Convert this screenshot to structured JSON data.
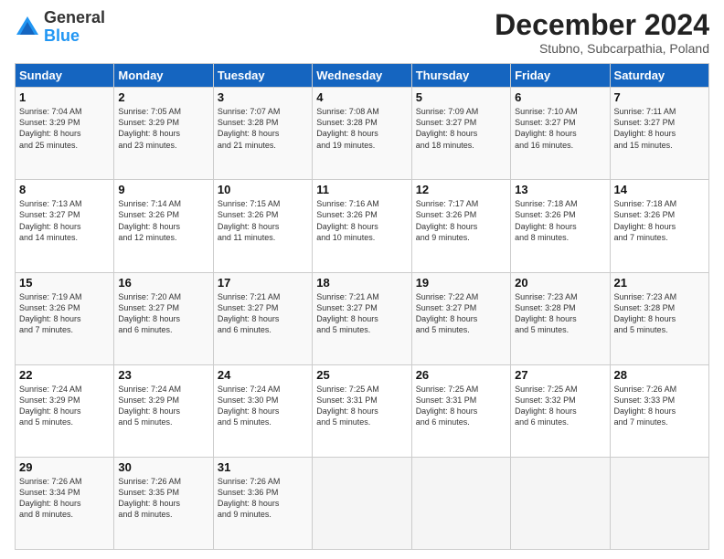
{
  "logo": {
    "general": "General",
    "blue": "Blue"
  },
  "title": "December 2024",
  "subtitle": "Stubno, Subcarpathia, Poland",
  "days_of_week": [
    "Sunday",
    "Monday",
    "Tuesday",
    "Wednesday",
    "Thursday",
    "Friday",
    "Saturday"
  ],
  "weeks": [
    [
      {
        "day": "1",
        "lines": [
          "Sunrise: 7:04 AM",
          "Sunset: 3:29 PM",
          "Daylight: 8 hours",
          "and 25 minutes."
        ]
      },
      {
        "day": "2",
        "lines": [
          "Sunrise: 7:05 AM",
          "Sunset: 3:29 PM",
          "Daylight: 8 hours",
          "and 23 minutes."
        ]
      },
      {
        "day": "3",
        "lines": [
          "Sunrise: 7:07 AM",
          "Sunset: 3:28 PM",
          "Daylight: 8 hours",
          "and 21 minutes."
        ]
      },
      {
        "day": "4",
        "lines": [
          "Sunrise: 7:08 AM",
          "Sunset: 3:28 PM",
          "Daylight: 8 hours",
          "and 19 minutes."
        ]
      },
      {
        "day": "5",
        "lines": [
          "Sunrise: 7:09 AM",
          "Sunset: 3:27 PM",
          "Daylight: 8 hours",
          "and 18 minutes."
        ]
      },
      {
        "day": "6",
        "lines": [
          "Sunrise: 7:10 AM",
          "Sunset: 3:27 PM",
          "Daylight: 8 hours",
          "and 16 minutes."
        ]
      },
      {
        "day": "7",
        "lines": [
          "Sunrise: 7:11 AM",
          "Sunset: 3:27 PM",
          "Daylight: 8 hours",
          "and 15 minutes."
        ]
      }
    ],
    [
      {
        "day": "8",
        "lines": [
          "Sunrise: 7:13 AM",
          "Sunset: 3:27 PM",
          "Daylight: 8 hours",
          "and 14 minutes."
        ]
      },
      {
        "day": "9",
        "lines": [
          "Sunrise: 7:14 AM",
          "Sunset: 3:26 PM",
          "Daylight: 8 hours",
          "and 12 minutes."
        ]
      },
      {
        "day": "10",
        "lines": [
          "Sunrise: 7:15 AM",
          "Sunset: 3:26 PM",
          "Daylight: 8 hours",
          "and 11 minutes."
        ]
      },
      {
        "day": "11",
        "lines": [
          "Sunrise: 7:16 AM",
          "Sunset: 3:26 PM",
          "Daylight: 8 hours",
          "and 10 minutes."
        ]
      },
      {
        "day": "12",
        "lines": [
          "Sunrise: 7:17 AM",
          "Sunset: 3:26 PM",
          "Daylight: 8 hours",
          "and 9 minutes."
        ]
      },
      {
        "day": "13",
        "lines": [
          "Sunrise: 7:18 AM",
          "Sunset: 3:26 PM",
          "Daylight: 8 hours",
          "and 8 minutes."
        ]
      },
      {
        "day": "14",
        "lines": [
          "Sunrise: 7:18 AM",
          "Sunset: 3:26 PM",
          "Daylight: 8 hours",
          "and 7 minutes."
        ]
      }
    ],
    [
      {
        "day": "15",
        "lines": [
          "Sunrise: 7:19 AM",
          "Sunset: 3:26 PM",
          "Daylight: 8 hours",
          "and 7 minutes."
        ]
      },
      {
        "day": "16",
        "lines": [
          "Sunrise: 7:20 AM",
          "Sunset: 3:27 PM",
          "Daylight: 8 hours",
          "and 6 minutes."
        ]
      },
      {
        "day": "17",
        "lines": [
          "Sunrise: 7:21 AM",
          "Sunset: 3:27 PM",
          "Daylight: 8 hours",
          "and 6 minutes."
        ]
      },
      {
        "day": "18",
        "lines": [
          "Sunrise: 7:21 AM",
          "Sunset: 3:27 PM",
          "Daylight: 8 hours",
          "and 5 minutes."
        ]
      },
      {
        "day": "19",
        "lines": [
          "Sunrise: 7:22 AM",
          "Sunset: 3:27 PM",
          "Daylight: 8 hours",
          "and 5 minutes."
        ]
      },
      {
        "day": "20",
        "lines": [
          "Sunrise: 7:23 AM",
          "Sunset: 3:28 PM",
          "Daylight: 8 hours",
          "and 5 minutes."
        ]
      },
      {
        "day": "21",
        "lines": [
          "Sunrise: 7:23 AM",
          "Sunset: 3:28 PM",
          "Daylight: 8 hours",
          "and 5 minutes."
        ]
      }
    ],
    [
      {
        "day": "22",
        "lines": [
          "Sunrise: 7:24 AM",
          "Sunset: 3:29 PM",
          "Daylight: 8 hours",
          "and 5 minutes."
        ]
      },
      {
        "day": "23",
        "lines": [
          "Sunrise: 7:24 AM",
          "Sunset: 3:29 PM",
          "Daylight: 8 hours",
          "and 5 minutes."
        ]
      },
      {
        "day": "24",
        "lines": [
          "Sunrise: 7:24 AM",
          "Sunset: 3:30 PM",
          "Daylight: 8 hours",
          "and 5 minutes."
        ]
      },
      {
        "day": "25",
        "lines": [
          "Sunrise: 7:25 AM",
          "Sunset: 3:31 PM",
          "Daylight: 8 hours",
          "and 5 minutes."
        ]
      },
      {
        "day": "26",
        "lines": [
          "Sunrise: 7:25 AM",
          "Sunset: 3:31 PM",
          "Daylight: 8 hours",
          "and 6 minutes."
        ]
      },
      {
        "day": "27",
        "lines": [
          "Sunrise: 7:25 AM",
          "Sunset: 3:32 PM",
          "Daylight: 8 hours",
          "and 6 minutes."
        ]
      },
      {
        "day": "28",
        "lines": [
          "Sunrise: 7:26 AM",
          "Sunset: 3:33 PM",
          "Daylight: 8 hours",
          "and 7 minutes."
        ]
      }
    ],
    [
      {
        "day": "29",
        "lines": [
          "Sunrise: 7:26 AM",
          "Sunset: 3:34 PM",
          "Daylight: 8 hours",
          "and 8 minutes."
        ]
      },
      {
        "day": "30",
        "lines": [
          "Sunrise: 7:26 AM",
          "Sunset: 3:35 PM",
          "Daylight: 8 hours",
          "and 8 minutes."
        ]
      },
      {
        "day": "31",
        "lines": [
          "Sunrise: 7:26 AM",
          "Sunset: 3:36 PM",
          "Daylight: 8 hours",
          "and 9 minutes."
        ]
      },
      null,
      null,
      null,
      null
    ]
  ]
}
